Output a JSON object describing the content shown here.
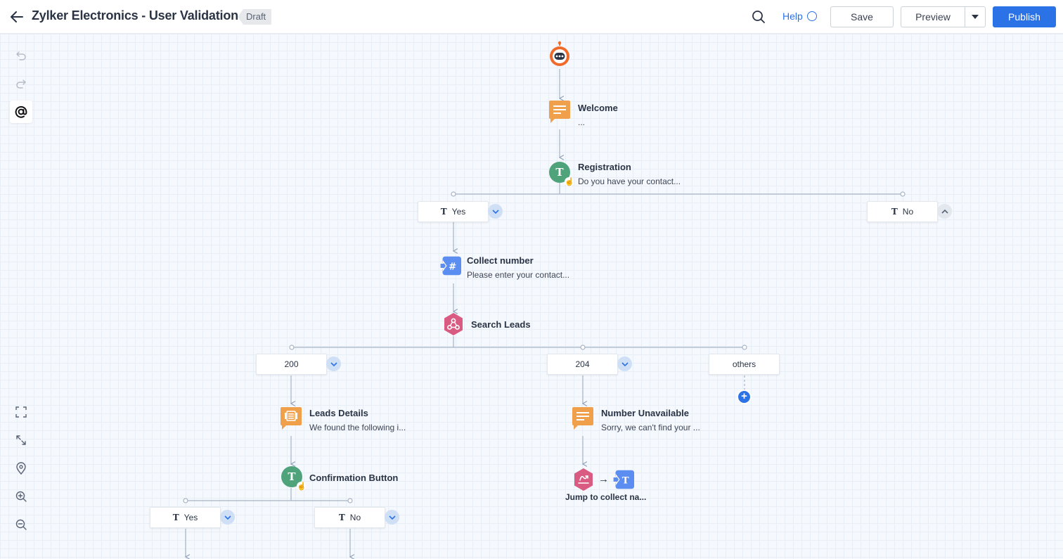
{
  "header": {
    "title": "Zylker Electronics - User Validation",
    "status": "Draft",
    "help_label": "Help",
    "help_glyph": "?",
    "save_label": "Save",
    "preview_label": "Preview",
    "publish_label": "Publish"
  },
  "colors": {
    "accent": "#2b72e6",
    "message_orange": "#f0a04b",
    "input_green": "#4ea37a",
    "webhook_pink": "#d95b82",
    "number_blue": "#5b8ef0",
    "bot_orange": "#f06a2a"
  },
  "nodes": {
    "welcome": {
      "title": "Welcome",
      "subtitle": "..."
    },
    "registration": {
      "title": "Registration",
      "subtitle": "Do you have your contact..."
    },
    "collect_number": {
      "title": "Collect number",
      "subtitle": "Please enter your contact..."
    },
    "search_leads": {
      "title": "Search Leads"
    },
    "leads_details": {
      "title": "Leads Details",
      "subtitle": "We found the following i..."
    },
    "number_unavailable": {
      "title": "Number Unavailable",
      "subtitle": "Sorry, we can't find your ..."
    },
    "confirmation_button": {
      "title": "Confirmation Button"
    },
    "jump": {
      "title": "Jump to collect na..."
    }
  },
  "options": {
    "registration_yes": "Yes",
    "registration_no": "No",
    "status_200": "200",
    "status_204": "204",
    "status_others": "others",
    "confirm_yes": "Yes",
    "confirm_no": "No"
  },
  "glyphs": {
    "text_input": "T",
    "number_input": "#",
    "plus": "+",
    "arrow": "→"
  }
}
